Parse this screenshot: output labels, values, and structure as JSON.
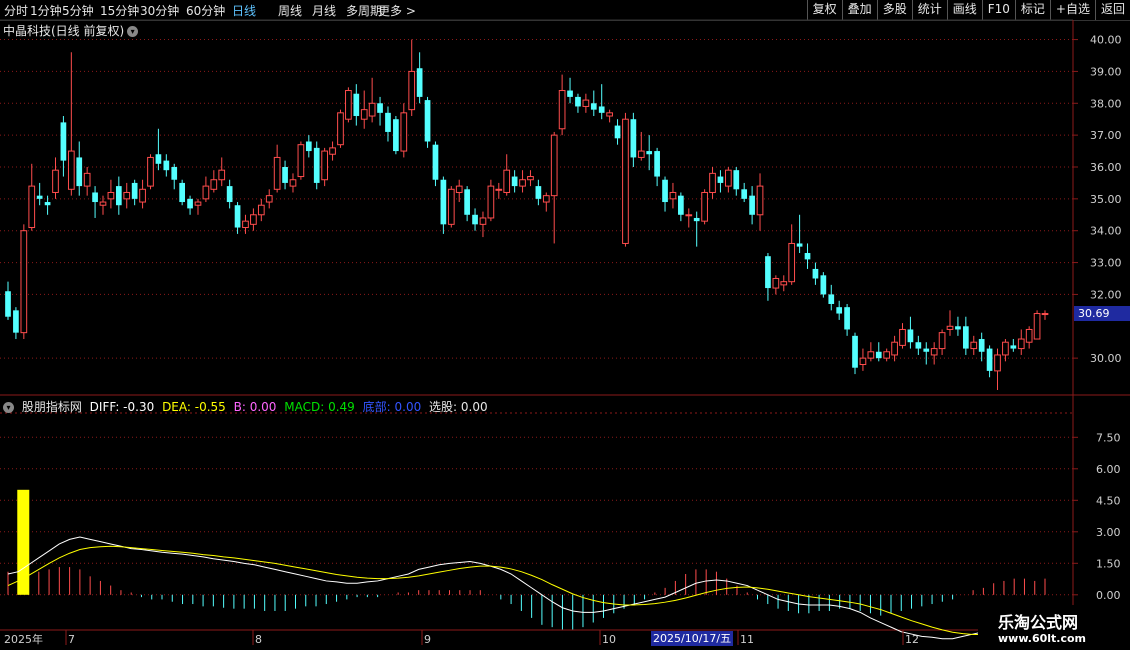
{
  "toolbar": {
    "periods": [
      "分时",
      "1分钟",
      "5分钟",
      "15分钟",
      "30分钟",
      "60分钟",
      "日线",
      "周线",
      "月线",
      "多周期",
      "更多 >"
    ],
    "active_period": "日线",
    "right_buttons": [
      "复权",
      "叠加",
      "多股",
      "统计",
      "画线",
      "F10",
      "标记",
      "+自选",
      "返回"
    ]
  },
  "stock": {
    "title": "中晶科技(日线 前复权)"
  },
  "price_axis": {
    "labels": [
      "40.00",
      "39.00",
      "38.00",
      "37.00",
      "36.00",
      "35.00",
      "34.00",
      "33.00",
      "32.00",
      "30.00"
    ],
    "current_price": "30.69"
  },
  "indicator": {
    "name": "股朋指标网",
    "diff": "DIFF: -0.30",
    "dea": "DEA: -0.55",
    "b": "B: 0.00",
    "macd": "MACD: 0.49",
    "bottom": "底部: 0.00",
    "pick": "选股: 0.00",
    "axis_labels": [
      "7.50",
      "6.00",
      "4.50",
      "3.00",
      "1.50",
      "0.00"
    ]
  },
  "date_axis": {
    "year": "2025年",
    "months": [
      "7",
      "8",
      "9",
      "10",
      "11",
      "12"
    ],
    "cursor_date": "2025/10/17/五"
  },
  "colors": {
    "up": "#ff4d4d",
    "down": "#54ffff",
    "diff": "#ffffff",
    "dea": "#ffff00",
    "signal": "#ffff00",
    "grid": "#8b1a1a"
  },
  "chart_data": {
    "type": "candlestick",
    "ylim": [
      29.0,
      40.3
    ],
    "candles": [
      {
        "o": 32.1,
        "c": 31.3,
        "h": 32.4,
        "l": 31.2
      },
      {
        "o": 31.5,
        "c": 30.8,
        "h": 31.6,
        "l": 30.6
      },
      {
        "o": 30.8,
        "c": 34.0,
        "h": 34.2,
        "l": 30.6
      },
      {
        "o": 34.1,
        "c": 35.4,
        "h": 36.1,
        "l": 34.0
      },
      {
        "o": 35.1,
        "c": 35.0,
        "h": 35.5,
        "l": 34.8
      },
      {
        "o": 34.9,
        "c": 34.8,
        "h": 35.1,
        "l": 34.5
      },
      {
        "o": 35.2,
        "c": 35.9,
        "h": 36.3,
        "l": 35.0
      },
      {
        "o": 37.4,
        "c": 36.2,
        "h": 37.6,
        "l": 35.7
      },
      {
        "o": 35.3,
        "c": 36.5,
        "h": 39.6,
        "l": 35.1
      },
      {
        "o": 36.3,
        "c": 35.4,
        "h": 36.8,
        "l": 35.1
      },
      {
        "o": 35.4,
        "c": 35.8,
        "h": 36.0,
        "l": 35.1
      },
      {
        "o": 35.2,
        "c": 34.9,
        "h": 35.4,
        "l": 34.4
      },
      {
        "o": 34.8,
        "c": 34.9,
        "h": 35.1,
        "l": 34.5
      },
      {
        "o": 35.0,
        "c": 35.2,
        "h": 35.6,
        "l": 34.7
      },
      {
        "o": 35.4,
        "c": 34.8,
        "h": 35.7,
        "l": 34.5
      },
      {
        "o": 35.0,
        "c": 35.2,
        "h": 35.5,
        "l": 34.7
      },
      {
        "o": 35.5,
        "c": 35.0,
        "h": 35.6,
        "l": 34.8
      },
      {
        "o": 34.9,
        "c": 35.3,
        "h": 35.6,
        "l": 34.7
      },
      {
        "o": 35.4,
        "c": 36.3,
        "h": 36.4,
        "l": 35.3
      },
      {
        "o": 36.4,
        "c": 36.1,
        "h": 37.2,
        "l": 35.9
      },
      {
        "o": 36.2,
        "c": 35.9,
        "h": 36.4,
        "l": 35.7
      },
      {
        "o": 36.0,
        "c": 35.6,
        "h": 36.1,
        "l": 35.3
      },
      {
        "o": 35.5,
        "c": 34.9,
        "h": 35.6,
        "l": 34.8
      },
      {
        "o": 35.0,
        "c": 34.7,
        "h": 35.1,
        "l": 34.5
      },
      {
        "o": 34.8,
        "c": 34.9,
        "h": 35.0,
        "l": 34.5
      },
      {
        "o": 35.0,
        "c": 35.4,
        "h": 35.7,
        "l": 34.9
      },
      {
        "o": 35.3,
        "c": 35.6,
        "h": 35.9,
        "l": 35.2
      },
      {
        "o": 35.6,
        "c": 35.9,
        "h": 36.3,
        "l": 35.4
      },
      {
        "o": 35.4,
        "c": 34.9,
        "h": 35.6,
        "l": 34.7
      },
      {
        "o": 34.8,
        "c": 34.1,
        "h": 34.9,
        "l": 33.9
      },
      {
        "o": 34.1,
        "c": 34.3,
        "h": 34.5,
        "l": 33.9
      },
      {
        "o": 34.2,
        "c": 34.5,
        "h": 34.7,
        "l": 34.0
      },
      {
        "o": 34.5,
        "c": 34.8,
        "h": 35.0,
        "l": 34.3
      },
      {
        "o": 34.9,
        "c": 35.1,
        "h": 35.3,
        "l": 34.7
      },
      {
        "o": 35.3,
        "c": 36.3,
        "h": 36.7,
        "l": 35.2
      },
      {
        "o": 36.0,
        "c": 35.5,
        "h": 36.2,
        "l": 35.3
      },
      {
        "o": 35.4,
        "c": 35.6,
        "h": 35.8,
        "l": 35.2
      },
      {
        "o": 35.7,
        "c": 36.7,
        "h": 36.8,
        "l": 35.6
      },
      {
        "o": 36.8,
        "c": 36.5,
        "h": 37.0,
        "l": 36.3
      },
      {
        "o": 36.6,
        "c": 35.5,
        "h": 36.8,
        "l": 35.3
      },
      {
        "o": 35.6,
        "c": 36.5,
        "h": 36.6,
        "l": 35.4
      },
      {
        "o": 36.4,
        "c": 36.6,
        "h": 36.8,
        "l": 36.2
      },
      {
        "o": 36.7,
        "c": 37.7,
        "h": 37.8,
        "l": 36.6
      },
      {
        "o": 37.5,
        "c": 38.4,
        "h": 38.5,
        "l": 37.4
      },
      {
        "o": 38.3,
        "c": 37.6,
        "h": 38.6,
        "l": 37.3
      },
      {
        "o": 37.5,
        "c": 37.8,
        "h": 38.4,
        "l": 37.2
      },
      {
        "o": 37.6,
        "c": 38.0,
        "h": 38.8,
        "l": 37.4
      },
      {
        "o": 38.0,
        "c": 37.7,
        "h": 38.2,
        "l": 37.3
      },
      {
        "o": 37.7,
        "c": 37.1,
        "h": 37.9,
        "l": 36.8
      },
      {
        "o": 37.5,
        "c": 36.5,
        "h": 37.6,
        "l": 36.4
      },
      {
        "o": 36.5,
        "c": 37.7,
        "h": 38.0,
        "l": 36.3
      },
      {
        "o": 37.8,
        "c": 39.0,
        "h": 40.0,
        "l": 37.6
      },
      {
        "o": 39.1,
        "c": 38.2,
        "h": 39.6,
        "l": 38.0
      },
      {
        "o": 38.1,
        "c": 36.8,
        "h": 38.2,
        "l": 36.6
      },
      {
        "o": 36.7,
        "c": 35.6,
        "h": 36.8,
        "l": 35.4
      },
      {
        "o": 35.6,
        "c": 34.2,
        "h": 35.7,
        "l": 33.9
      },
      {
        "o": 34.2,
        "c": 35.3,
        "h": 35.4,
        "l": 34.1
      },
      {
        "o": 35.2,
        "c": 35.4,
        "h": 35.6,
        "l": 34.9
      },
      {
        "o": 35.3,
        "c": 34.5,
        "h": 35.4,
        "l": 34.3
      },
      {
        "o": 34.5,
        "c": 34.2,
        "h": 34.7,
        "l": 34.0
      },
      {
        "o": 34.2,
        "c": 34.4,
        "h": 34.6,
        "l": 33.8
      },
      {
        "o": 34.4,
        "c": 35.4,
        "h": 35.6,
        "l": 34.3
      },
      {
        "o": 35.3,
        "c": 35.3,
        "h": 35.5,
        "l": 35.0
      },
      {
        "o": 35.2,
        "c": 35.9,
        "h": 36.4,
        "l": 35.1
      },
      {
        "o": 35.7,
        "c": 35.4,
        "h": 35.9,
        "l": 35.2
      },
      {
        "o": 35.4,
        "c": 35.6,
        "h": 35.9,
        "l": 35.2
      },
      {
        "o": 35.6,
        "c": 35.7,
        "h": 35.9,
        "l": 35.4
      },
      {
        "o": 35.4,
        "c": 35.0,
        "h": 35.6,
        "l": 34.8
      },
      {
        "o": 34.9,
        "c": 35.1,
        "h": 35.2,
        "l": 34.6
      },
      {
        "o": 35.1,
        "c": 37.0,
        "h": 37.1,
        "l": 33.6
      },
      {
        "o": 37.2,
        "c": 38.4,
        "h": 38.9,
        "l": 37.0
      },
      {
        "o": 38.4,
        "c": 38.2,
        "h": 38.8,
        "l": 38.0
      },
      {
        "o": 38.2,
        "c": 37.9,
        "h": 38.3,
        "l": 37.7
      },
      {
        "o": 37.9,
        "c": 38.1,
        "h": 38.3,
        "l": 37.7
      },
      {
        "o": 38.0,
        "c": 37.8,
        "h": 38.4,
        "l": 37.6
      },
      {
        "o": 37.9,
        "c": 37.7,
        "h": 38.6,
        "l": 37.5
      },
      {
        "o": 37.6,
        "c": 37.7,
        "h": 37.8,
        "l": 37.4
      },
      {
        "o": 37.3,
        "c": 36.9,
        "h": 37.5,
        "l": 36.7
      },
      {
        "o": 33.6,
        "c": 37.5,
        "h": 37.7,
        "l": 33.5
      },
      {
        "o": 37.5,
        "c": 36.3,
        "h": 37.7,
        "l": 36.0
      },
      {
        "o": 36.3,
        "c": 36.5,
        "h": 37.1,
        "l": 36.2
      },
      {
        "o": 36.5,
        "c": 36.4,
        "h": 37.0,
        "l": 35.9
      },
      {
        "o": 36.5,
        "c": 35.7,
        "h": 36.6,
        "l": 35.4
      },
      {
        "o": 35.6,
        "c": 34.9,
        "h": 35.7,
        "l": 34.6
      },
      {
        "o": 35.0,
        "c": 35.2,
        "h": 35.5,
        "l": 34.7
      },
      {
        "o": 35.1,
        "c": 34.5,
        "h": 35.2,
        "l": 34.3
      },
      {
        "o": 34.5,
        "c": 34.5,
        "h": 34.7,
        "l": 34.1
      },
      {
        "o": 34.4,
        "c": 34.3,
        "h": 34.6,
        "l": 33.5
      },
      {
        "o": 34.3,
        "c": 35.2,
        "h": 35.3,
        "l": 34.2
      },
      {
        "o": 35.2,
        "c": 35.8,
        "h": 36.0,
        "l": 35.0
      },
      {
        "o": 35.7,
        "c": 35.5,
        "h": 35.9,
        "l": 35.2
      },
      {
        "o": 35.4,
        "c": 35.9,
        "h": 36.0,
        "l": 35.2
      },
      {
        "o": 35.9,
        "c": 35.3,
        "h": 36.0,
        "l": 35.1
      },
      {
        "o": 35.3,
        "c": 35.0,
        "h": 35.5,
        "l": 34.9
      },
      {
        "o": 35.1,
        "c": 34.5,
        "h": 35.4,
        "l": 34.2
      },
      {
        "o": 34.5,
        "c": 35.4,
        "h": 35.8,
        "l": 34.0
      },
      {
        "o": 33.2,
        "c": 32.2,
        "h": 33.3,
        "l": 31.8
      },
      {
        "o": 32.2,
        "c": 32.5,
        "h": 32.6,
        "l": 32.0
      },
      {
        "o": 32.3,
        "c": 32.4,
        "h": 32.6,
        "l": 32.1
      },
      {
        "o": 32.4,
        "c": 33.6,
        "h": 34.2,
        "l": 32.3
      },
      {
        "o": 33.6,
        "c": 33.5,
        "h": 34.5,
        "l": 33.3
      },
      {
        "o": 33.3,
        "c": 33.1,
        "h": 33.6,
        "l": 32.8
      },
      {
        "o": 32.8,
        "c": 32.5,
        "h": 33.0,
        "l": 32.3
      },
      {
        "o": 32.6,
        "c": 32.0,
        "h": 32.7,
        "l": 31.9
      },
      {
        "o": 32.0,
        "c": 31.7,
        "h": 32.3,
        "l": 31.5
      },
      {
        "o": 31.6,
        "c": 31.4,
        "h": 31.8,
        "l": 31.2
      },
      {
        "o": 31.6,
        "c": 30.9,
        "h": 31.7,
        "l": 30.7
      },
      {
        "o": 30.7,
        "c": 29.7,
        "h": 30.8,
        "l": 29.5
      },
      {
        "o": 29.8,
        "c": 30.0,
        "h": 30.3,
        "l": 29.6
      },
      {
        "o": 30.0,
        "c": 30.2,
        "h": 30.5,
        "l": 29.9
      },
      {
        "o": 30.2,
        "c": 30.0,
        "h": 30.5,
        "l": 29.9
      },
      {
        "o": 30.0,
        "c": 30.2,
        "h": 30.3,
        "l": 29.9
      },
      {
        "o": 30.1,
        "c": 30.5,
        "h": 30.7,
        "l": 29.9
      },
      {
        "o": 30.4,
        "c": 30.9,
        "h": 31.1,
        "l": 30.3
      },
      {
        "o": 30.9,
        "c": 30.5,
        "h": 31.3,
        "l": 30.3
      },
      {
        "o": 30.5,
        "c": 30.3,
        "h": 30.7,
        "l": 30.1
      },
      {
        "o": 30.3,
        "c": 30.2,
        "h": 30.5,
        "l": 29.8
      },
      {
        "o": 30.1,
        "c": 30.3,
        "h": 30.5,
        "l": 29.8
      },
      {
        "o": 30.3,
        "c": 30.8,
        "h": 30.9,
        "l": 30.1
      },
      {
        "o": 30.9,
        "c": 31.0,
        "h": 31.5,
        "l": 30.7
      },
      {
        "o": 31.0,
        "c": 30.9,
        "h": 31.3,
        "l": 30.7
      },
      {
        "o": 31.0,
        "c": 30.3,
        "h": 31.3,
        "l": 30.1
      },
      {
        "o": 30.3,
        "c": 30.5,
        "h": 30.7,
        "l": 30.1
      },
      {
        "o": 30.6,
        "c": 30.2,
        "h": 30.8,
        "l": 29.9
      },
      {
        "o": 30.3,
        "c": 29.6,
        "h": 30.4,
        "l": 29.4
      },
      {
        "o": 29.6,
        "c": 30.1,
        "h": 30.3,
        "l": 29.0
      },
      {
        "o": 30.1,
        "c": 30.5,
        "h": 30.6,
        "l": 29.9
      },
      {
        "o": 30.4,
        "c": 30.3,
        "h": 30.6,
        "l": 30.2
      },
      {
        "o": 30.3,
        "c": 30.6,
        "h": 30.9,
        "l": 30.1
      },
      {
        "o": 30.5,
        "c": 30.9,
        "h": 31.0,
        "l": 30.3
      },
      {
        "o": 30.6,
        "c": 31.4,
        "h": 31.5,
        "l": 30.6
      },
      {
        "o": 31.4,
        "c": 31.4,
        "h": 31.5,
        "l": 31.2
      }
    ],
    "macd": {
      "ylim": [
        -1.2,
        8.8
      ],
      "signal_bar": {
        "index": 1,
        "value": 5.0
      },
      "diff": [
        0.45,
        0.5,
        0.65,
        0.8,
        0.95,
        1.1,
        1.2,
        1.25,
        1.2,
        1.15,
        1.1,
        1.05,
        1.0,
        0.98,
        0.95,
        0.92,
        0.9,
        0.88,
        0.85,
        0.82,
        0.78,
        0.75,
        0.72,
        0.68,
        0.65,
        0.6,
        0.55,
        0.5,
        0.45,
        0.4,
        0.35,
        0.3,
        0.28,
        0.25,
        0.25,
        0.28,
        0.3,
        0.35,
        0.4,
        0.45,
        0.55,
        0.6,
        0.65,
        0.68,
        0.7,
        0.72,
        0.68,
        0.62,
        0.55,
        0.45,
        0.3,
        0.15,
        0.0,
        -0.15,
        -0.28,
        -0.35,
        -0.38,
        -0.38,
        -0.35,
        -0.3,
        -0.25,
        -0.2,
        -0.15,
        -0.1,
        -0.05,
        0.05,
        0.15,
        0.25,
        0.3,
        0.32,
        0.3,
        0.25,
        0.2,
        0.1,
        0.0,
        -0.1,
        -0.15,
        -0.2,
        -0.22,
        -0.22,
        -0.22,
        -0.25,
        -0.3,
        -0.38,
        -0.5,
        -0.6,
        -0.7,
        -0.8,
        -0.85,
        -0.9,
        -0.92,
        -0.95,
        -0.95,
        -0.9,
        -0.85,
        -0.8,
        -0.7,
        -0.6,
        -0.5,
        -0.4,
        -0.35,
        -0.3
      ],
      "dea": [
        0.2,
        0.3,
        0.42,
        0.55,
        0.68,
        0.8,
        0.9,
        0.98,
        1.02,
        1.04,
        1.05,
        1.04,
        1.02,
        1.0,
        0.98,
        0.96,
        0.94,
        0.92,
        0.9,
        0.87,
        0.85,
        0.82,
        0.8,
        0.77,
        0.74,
        0.71,
        0.68,
        0.64,
        0.6,
        0.56,
        0.52,
        0.48,
        0.44,
        0.41,
        0.38,
        0.36,
        0.35,
        0.35,
        0.36,
        0.38,
        0.41,
        0.45,
        0.49,
        0.53,
        0.57,
        0.6,
        0.62,
        0.62,
        0.6,
        0.56,
        0.5,
        0.42,
        0.33,
        0.22,
        0.12,
        0.02,
        -0.06,
        -0.12,
        -0.17,
        -0.2,
        -0.22,
        -0.22,
        -0.21,
        -0.19,
        -0.16,
        -0.12,
        -0.07,
        -0.01,
        0.05,
        0.1,
        0.14,
        0.16,
        0.17,
        0.15,
        0.12,
        0.08,
        0.04,
        0.0,
        -0.04,
        -0.07,
        -0.1,
        -0.13,
        -0.16,
        -0.2,
        -0.26,
        -0.32,
        -0.4,
        -0.48,
        -0.56,
        -0.63,
        -0.7,
        -0.76,
        -0.81,
        -0.84,
        -0.86,
        -0.86,
        -0.84,
        -0.8,
        -0.75,
        -0.69,
        -0.62,
        -0.55
      ],
      "hist": [
        0.5,
        0.4,
        0.45,
        0.5,
        0.55,
        0.6,
        0.6,
        0.55,
        0.4,
        0.3,
        0.2,
        0.1,
        0.05,
        -0.05,
        -0.1,
        -0.1,
        -0.15,
        -0.2,
        -0.2,
        -0.25,
        -0.25,
        -0.28,
        -0.3,
        -0.3,
        -0.3,
        -0.35,
        -0.35,
        -0.35,
        -0.3,
        -0.25,
        -0.25,
        -0.2,
        -0.15,
        -0.1,
        -0.05,
        -0.05,
        -0.05,
        0.0,
        0.05,
        0.05,
        0.1,
        0.1,
        0.1,
        0.1,
        0.1,
        0.1,
        0.1,
        0.0,
        -0.1,
        -0.2,
        -0.35,
        -0.5,
        -0.65,
        -0.7,
        -0.75,
        -0.75,
        -0.7,
        -0.6,
        -0.5,
        -0.4,
        -0.3,
        -0.2,
        -0.1,
        0.05,
        0.15,
        0.3,
        0.45,
        0.55,
        0.55,
        0.5,
        0.35,
        0.2,
        0.05,
        -0.1,
        -0.2,
        -0.3,
        -0.35,
        -0.4,
        -0.4,
        -0.35,
        -0.35,
        -0.3,
        -0.3,
        -0.35,
        -0.4,
        -0.45,
        -0.4,
        -0.35,
        -0.3,
        -0.25,
        -0.2,
        -0.15,
        -0.1,
        0.0,
        0.1,
        0.15,
        0.25,
        0.3,
        0.35,
        0.35,
        0.3,
        0.35
      ]
    }
  }
}
